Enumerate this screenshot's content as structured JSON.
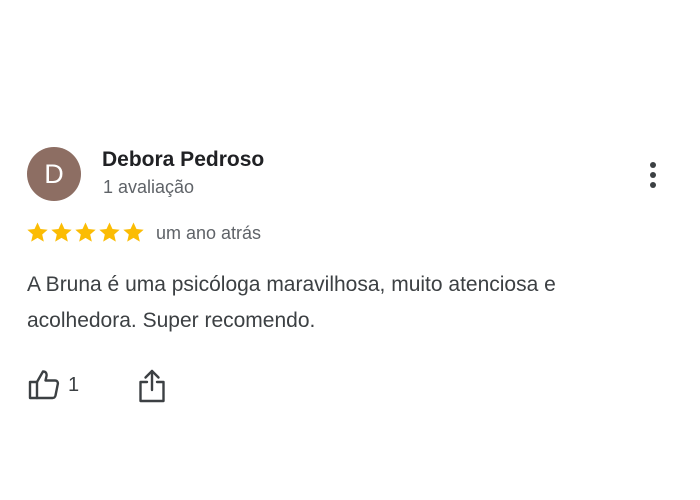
{
  "review": {
    "avatar_initial": "D",
    "author_name": "Debora Pedroso",
    "review_count": "1 avaliação",
    "rating": 5,
    "rating_max": 5,
    "date": "um ano atrás",
    "text": "A Bruna é uma psicóloga maravilhosa, muito atenciosa e acolhedora. Super recomendo.",
    "likes": "1"
  },
  "colors": {
    "avatar_bg": "#8d6e63",
    "star": "#fbbc04",
    "name": "#202124",
    "secondary_text": "#5f6368",
    "body_text": "#3c4043"
  },
  "icons": {
    "more": "more-vertical-icon",
    "like": "thumbs-up-icon",
    "share": "share-icon",
    "star": "star-icon"
  }
}
